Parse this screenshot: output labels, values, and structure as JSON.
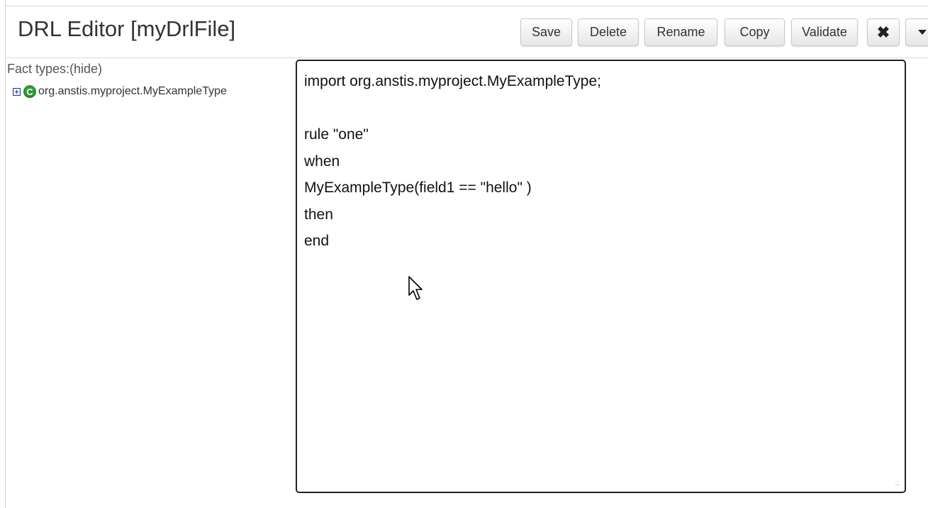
{
  "header": {
    "title": "DRL Editor [myDrlFile]",
    "buttons": {
      "save": "Save",
      "delete": "Delete",
      "rename": "Rename",
      "copy": "Copy",
      "validate": "Validate",
      "close_icon": "✖",
      "more_icon": "caret-down-icon"
    }
  },
  "sidebar": {
    "fact_types_label": "Fact types:(hide)",
    "items": [
      {
        "label": "org.anstis.myproject.MyExampleType",
        "icon": "class-icon",
        "icon_glyph": "C",
        "expand_icon": "expand-plus-icon"
      }
    ]
  },
  "editor": {
    "lines": [
      "import org.anstis.myproject.MyExampleType;",
      "",
      "rule \"one\"",
      "when",
      "MyExampleType(field1 == \"hello\" )",
      "then",
      "end"
    ]
  },
  "colors": {
    "class_icon": "#2e9b3a",
    "expand_icon_border": "#1f3f7f",
    "editor_border": "#222222"
  }
}
